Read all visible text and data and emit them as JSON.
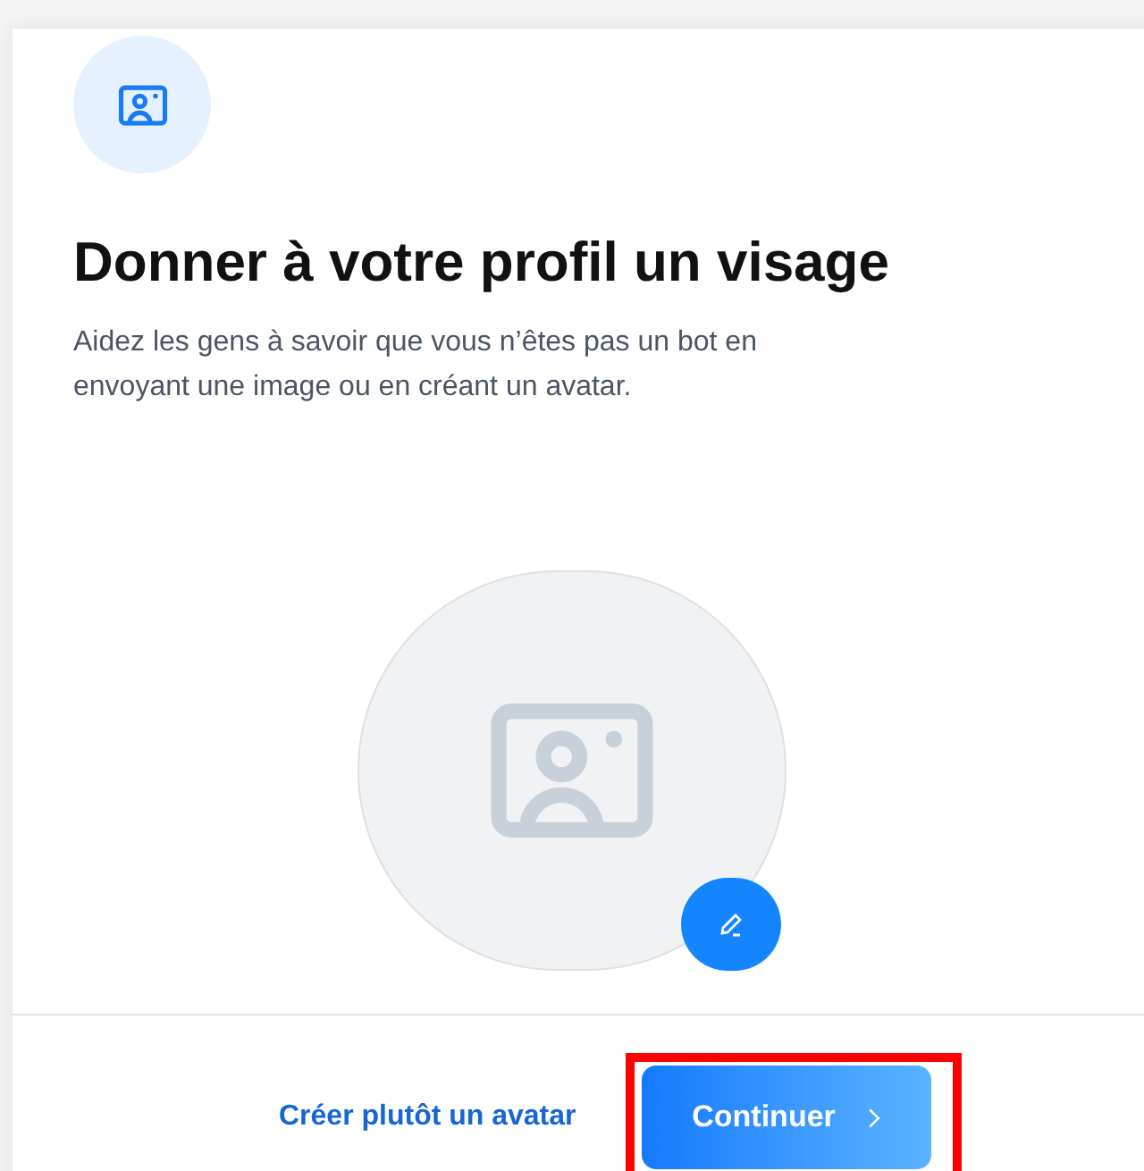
{
  "title": "Donner à votre profil un visage",
  "description": "Aidez les gens à savoir que vous n’êtes pas un bot en envoyant une image ou en créant un avatar.",
  "footer": {
    "link": "Créer plutôt un avatar",
    "button": "Continuer",
    "button_highlighted": true
  }
}
